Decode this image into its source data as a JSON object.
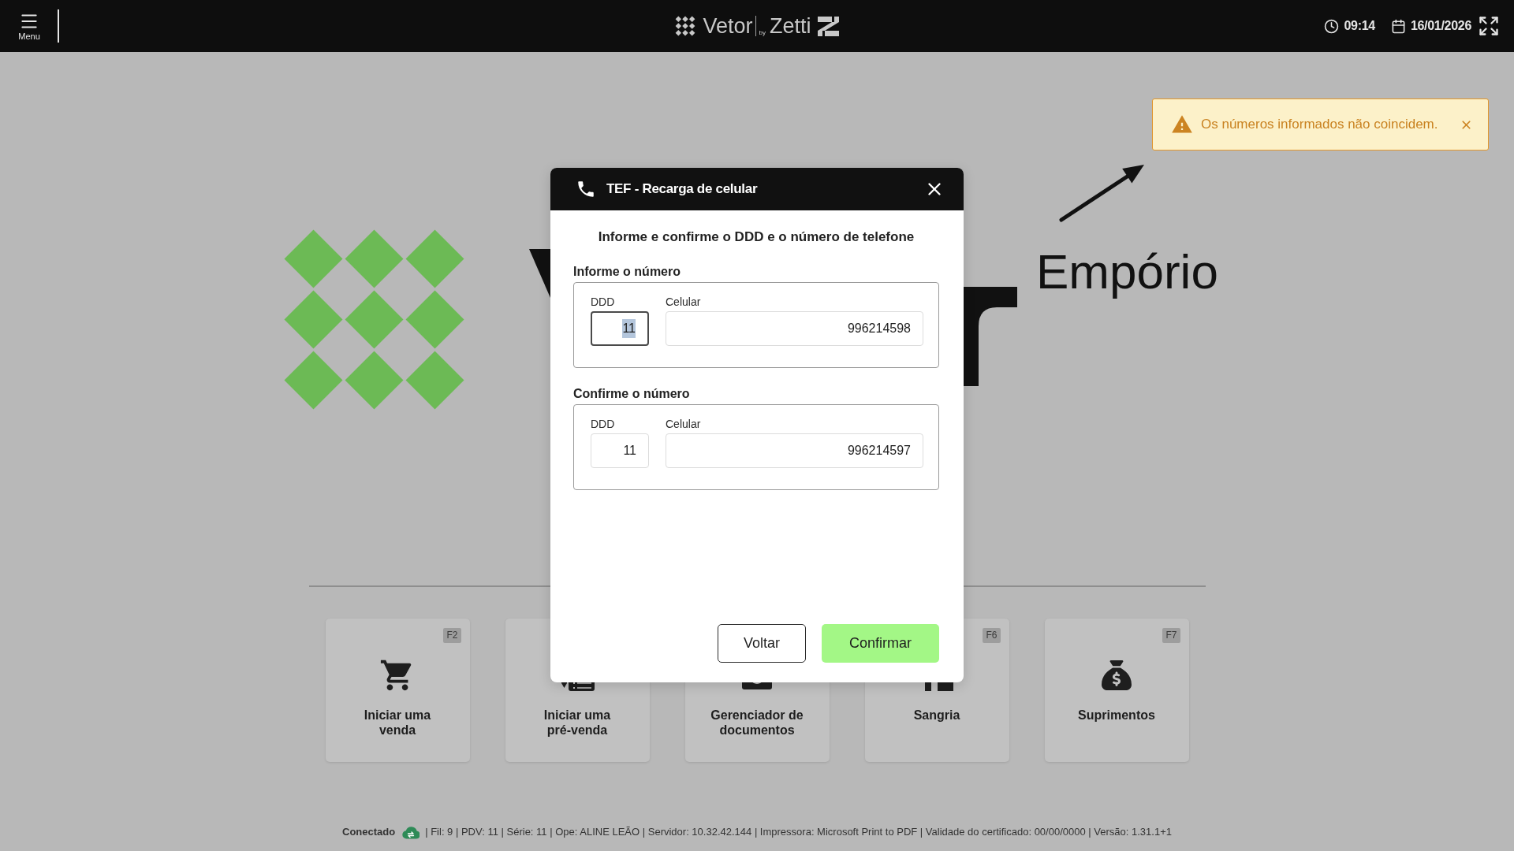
{
  "top_bar": {
    "menu_label": "Menu",
    "logo_name": "Vetor",
    "logo_by": "by",
    "logo_partner": "Zetti",
    "time": "09:14",
    "date": "16/01/2026"
  },
  "backdrop": {
    "brand_word": "Empório"
  },
  "shortcuts": [
    {
      "kind": "cart",
      "label": "Iniciar uma venda",
      "key": "F2"
    },
    {
      "kind": "presale",
      "label": "Iniciar uma pré-venda"
    },
    {
      "kind": "documents",
      "label": "Gerenciador de documentos"
    },
    {
      "kind": "withdrawal",
      "label": "Sangria",
      "key": "F6"
    },
    {
      "kind": "money-bag",
      "label": "Suprimentos",
      "key": "F7"
    }
  ],
  "status_bar": {
    "connection": "Conectado",
    "connected": true,
    "details": "| Fil: 9 | PDV: 11 | Série: 11 | Ope: ALINE LEÃO | Servidor: 10.32.42.144 | Impressora: Microsoft Print to PDF | Validade do certificado: 00/00/0000 | Versão: 1.31.1+1"
  },
  "dialog": {
    "title": "TEF - Recarga de celular",
    "instruction": "Informe e confirme o DDD e o número de telefone",
    "groups": [
      {
        "title": "Informe o número",
        "fields": [
          {
            "label": "DDD",
            "value": "11",
            "focused": true
          },
          {
            "label": "Celular",
            "value": "996214598",
            "focused": false
          }
        ]
      },
      {
        "title": "Confirme o número",
        "fields": [
          {
            "label": "DDD",
            "value": "11",
            "focused": false
          },
          {
            "label": "Celular",
            "value": "996214597",
            "focused": false
          }
        ]
      }
    ],
    "buttons": [
      {
        "kind": "secondary",
        "label": "Voltar"
      },
      {
        "kind": "primary",
        "label": "Confirmar"
      }
    ]
  },
  "toast": {
    "kind": "warning",
    "message": "Os números informados não coincidem."
  }
}
